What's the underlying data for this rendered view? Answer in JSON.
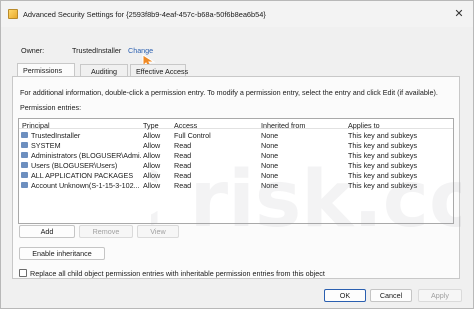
{
  "window": {
    "title": "Advanced Security Settings for {2593f8b9-4eaf-457c-b68a-50f6b8ea6b54}",
    "close_glyph": "✕"
  },
  "owner": {
    "label": "Owner:",
    "value": "TrustedInstaller",
    "change_link": "Change"
  },
  "tabs": [
    {
      "label": "Permissions",
      "active": true
    },
    {
      "label": "Auditing",
      "active": false
    },
    {
      "label": "Effective Access",
      "active": false
    }
  ],
  "panel": {
    "info_text": "For additional information, double-click a permission entry. To modify a permission entry, select the entry and click Edit (if available).",
    "entries_label": "Permission entries:"
  },
  "listview": {
    "columns": [
      "Principal",
      "Type",
      "Access",
      "Inherited from",
      "Applies to"
    ],
    "rows": [
      {
        "icon": "user-icon",
        "principal": "TrustedInstaller",
        "type": "Allow",
        "access": "Full Control",
        "inherited": "None",
        "applies": "This key and subkeys"
      },
      {
        "icon": "group-icon",
        "principal": "SYSTEM",
        "type": "Allow",
        "access": "Read",
        "inherited": "None",
        "applies": "This key and subkeys"
      },
      {
        "icon": "group-icon",
        "principal": "Administrators (BLOGUSER\\Admi...",
        "type": "Allow",
        "access": "Read",
        "inherited": "None",
        "applies": "This key and subkeys"
      },
      {
        "icon": "group-icon",
        "principal": "Users (BLOGUSER\\Users)",
        "type": "Allow",
        "access": "Read",
        "inherited": "None",
        "applies": "This key and subkeys"
      },
      {
        "icon": "group-icon",
        "principal": "ALL APPLICATION PACKAGES",
        "type": "Allow",
        "access": "Read",
        "inherited": "None",
        "applies": "This key and subkeys"
      },
      {
        "icon": "user-icon",
        "principal": "Account Unknown(S-1-15-3-102...",
        "type": "Allow",
        "access": "Read",
        "inherited": "None",
        "applies": "This key and subkeys"
      }
    ]
  },
  "buttons": {
    "add": "Add",
    "remove": "Remove",
    "view": "View",
    "enable_inheritance": "Enable inheritance",
    "ok": "OK",
    "cancel": "Cancel",
    "apply": "Apply"
  },
  "replace_checkbox": {
    "label": "Replace all child object permission entries with inheritable permission entries from this object",
    "checked": false
  },
  "watermark": {
    "text": "PC risk.com"
  },
  "colors": {
    "link": "#2a5fb0",
    "accent_arrow": "#f08a24"
  }
}
